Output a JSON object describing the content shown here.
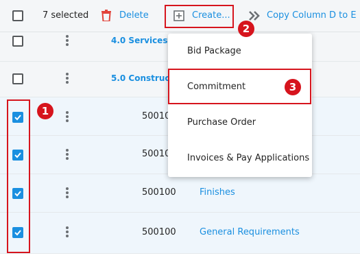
{
  "toolbar": {
    "selected_count": "7 selected",
    "delete_label": "Delete",
    "create_label": "Create...",
    "copy_label": "Copy Column D to E"
  },
  "rows": [
    {
      "type": "group",
      "checked": false,
      "name": "4.0 Services D"
    },
    {
      "type": "group",
      "checked": false,
      "name": "5.0 Construct"
    },
    {
      "type": "item",
      "checked": true,
      "code": "50010",
      "name": ""
    },
    {
      "type": "item",
      "checked": true,
      "code": "50010",
      "name": ""
    },
    {
      "type": "item",
      "checked": true,
      "code": "500100",
      "name": "Finishes"
    },
    {
      "type": "item",
      "checked": true,
      "code": "500100",
      "name": "General Requirements"
    }
  ],
  "create_menu": {
    "items": [
      "Bid Package",
      "Commitment",
      "Purchase Order",
      "Invoices & Pay Applications"
    ]
  },
  "annotations": {
    "badges": [
      "1",
      "2",
      "3"
    ]
  },
  "colors": {
    "accent": "#1a8fe0",
    "annotation": "#d6141d",
    "delete_icon": "#e2443b"
  },
  "icons": [
    "trash-icon",
    "plus-square-icon",
    "double-chevron-right-icon",
    "kebab-menu-icon",
    "checkmark-icon"
  ]
}
